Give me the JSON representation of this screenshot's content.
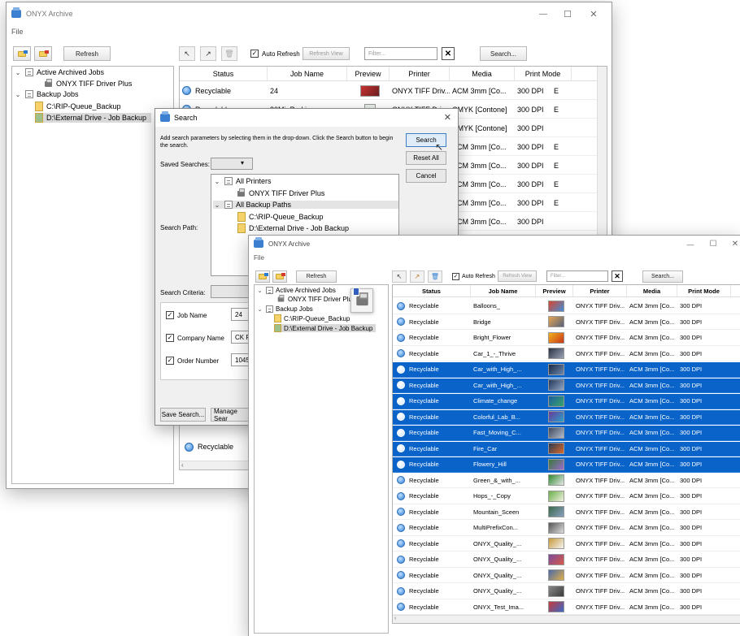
{
  "colors": {
    "selection": "#0a63c9",
    "accent": "#2f7fd3",
    "folder": "#f6d36a"
  },
  "back": {
    "title": "ONYX Archive",
    "menu": "File",
    "win_controls": {
      "min": "—",
      "max": "☐",
      "close": "✕"
    },
    "refresh": "Refresh",
    "auto_refresh": "Auto Refresh",
    "refresh_view": "Refresh View",
    "filter_placeholder": "Filter...",
    "search": "Search...",
    "tree": {
      "active": "Active Archived Jobs",
      "printer": "ONYX TIFF Driver Plus",
      "backup": "Backup Jobs",
      "path1": "C:\\RIP-Queue_Backup",
      "path2": "D:\\External Drive - Job Backup"
    },
    "columns": [
      "Status",
      "Job Name",
      "Preview",
      "Printer",
      "Media",
      "Print Mode"
    ],
    "rows": [
      {
        "status": "Recyclable",
        "job": "24",
        "printer": "ONYX TIFF Driv...",
        "media": "ACM 3mm [Co...",
        "mode": "300 DPI",
        "extra": "E"
      },
      {
        "status": "Recyclable",
        "job": "30MinParking",
        "printer": "ONYX TIFF Driv...",
        "media": "CMYK [Contone]",
        "mode": "300 DPI",
        "extra": "E"
      },
      {
        "media": "CMYK [Contone]",
        "mode": "300 DPI"
      },
      {
        "media": "ACM 3mm [Co...",
        "mode": "300 DPI",
        "extra": "E"
      },
      {
        "media": "ACM 3mm [Co...",
        "mode": "300 DPI",
        "extra": "E"
      },
      {
        "media": "ACM 3mm [Co...",
        "mode": "300 DPI",
        "extra": "E"
      },
      {
        "media": "ACM 3mm [Co...",
        "mode": "300 DPI",
        "extra": "E"
      },
      {
        "media": "ACM 3mm [Co...",
        "mode": "300 DPI"
      }
    ],
    "bottom_status": "Recyclable"
  },
  "dialog": {
    "title": "Search",
    "close": "✕",
    "instructions": "Add search parameters by selecting them in the drop-down. Click the Search button to begin the search.",
    "saved_label": "Saved Searches:",
    "path_label": "Search Path:",
    "criteria_label": "Search Criteria:",
    "search_btn": "Search",
    "reset_btn": "Reset All",
    "cancel_btn": "Cancel",
    "tree": {
      "all_printers": "All Printers",
      "printer": "ONYX TIFF Driver Plus",
      "all_paths": "All Backup Paths",
      "path1": "C:\\RIP-Queue_Backup",
      "path2": "D:\\External Drive - Job Backup"
    },
    "criteria": [
      {
        "label": "Job Name",
        "value": "24"
      },
      {
        "label": "Company Name",
        "value": "CK Pr"
      },
      {
        "label": "Order Number",
        "value": "1045"
      }
    ],
    "save_search": "Save Search...",
    "manage": "Manage Sear"
  },
  "front": {
    "title": "ONYX Archive",
    "menu": "File",
    "win_controls": {
      "min": "—",
      "max": "☐",
      "close": "✕"
    },
    "refresh": "Refresh",
    "auto_refresh": "Auto Refresh",
    "refresh_view": "Refresh View",
    "filter_placeholder": "Filter...",
    "search": "Search...",
    "tree": {
      "active": "Active Archived Jobs",
      "printer": "ONYX TIFF Driver Plus",
      "backup": "Backup Jobs",
      "path1": "C:\\RIP-Queue_Backup",
      "path2": "D:\\External Drive - Job Backup"
    },
    "columns": [
      "Status",
      "Job Name",
      "Preview",
      "Printer",
      "Media",
      "Print Mode"
    ],
    "rows": [
      {
        "status": "Recyclable",
        "job": "Balloons_",
        "printer": "ONYX TIFF Driv...",
        "media": "ACM 3mm [Co...",
        "mode": "300 DPI",
        "sel": false,
        "c1": "#d9462f",
        "c2": "#3f8fd6"
      },
      {
        "status": "Recyclable",
        "job": "Bridge",
        "printer": "ONYX TIFF Driv...",
        "media": "ACM 3mm [Co...",
        "mode": "300 DPI",
        "sel": false,
        "c1": "#e6a552",
        "c2": "#55617a"
      },
      {
        "status": "Recyclable",
        "job": "Bright_Flower",
        "printer": "ONYX TIFF Driv...",
        "media": "ACM 3mm [Co...",
        "mode": "300 DPI",
        "sel": false,
        "c1": "#f2b21c",
        "c2": "#c9361a"
      },
      {
        "status": "Recyclable",
        "job": "Car_1_-_Thrive",
        "printer": "ONYX TIFF Driv...",
        "media": "ACM 3mm [Co...",
        "mode": "300 DPI",
        "sel": false,
        "c1": "#2a3242",
        "c2": "#9aa4b8"
      },
      {
        "status": "Recyclable",
        "job": "Car_with_High_...",
        "printer": "ONYX TIFF Driv...",
        "media": "ACM 3mm [Co...",
        "mode": "300 DPI",
        "sel": true,
        "c1": "#1c2a44",
        "c2": "#6c87b0"
      },
      {
        "status": "Recyclable",
        "job": "Car_with_High_...",
        "printer": "ONYX TIFF Driv...",
        "media": "ACM 3mm [Co...",
        "mode": "300 DPI",
        "sel": true,
        "c1": "#243856",
        "c2": "#8fa6c9"
      },
      {
        "status": "Recyclable",
        "job": "Climate_change",
        "printer": "ONYX TIFF Driv...",
        "media": "ACM 3mm [Co...",
        "mode": "300 DPI",
        "sel": true,
        "c1": "#1c5fa0",
        "c2": "#3aa36a"
      },
      {
        "status": "Recyclable",
        "job": "Colorful_Lab_B...",
        "printer": "ONYX TIFF Driv...",
        "media": "ACM 3mm [Co...",
        "mode": "300 DPI",
        "sel": true,
        "c1": "#6a3a9a",
        "c2": "#2aa0c8"
      },
      {
        "status": "Recyclable",
        "job": "Fast_Moving_C...",
        "printer": "ONYX TIFF Driv...",
        "media": "ACM 3mm [Co...",
        "mode": "300 DPI",
        "sel": true,
        "c1": "#404a5c",
        "c2": "#b0bccf"
      },
      {
        "status": "Recyclable",
        "job": "Fire_Car",
        "printer": "ONYX TIFF Driv...",
        "media": "ACM 3mm [Co...",
        "mode": "300 DPI",
        "sel": true,
        "c1": "#2b3a54",
        "c2": "#d86a2a"
      },
      {
        "status": "Recyclable",
        "job": "Flowery_Hill",
        "printer": "ONYX TIFF Driv...",
        "media": "ACM 3mm [Co...",
        "mode": "300 DPI",
        "sel": true,
        "c1": "#3a7a3a",
        "c2": "#9a6ad0"
      },
      {
        "status": "Recyclable",
        "job": "Green_&_with_...",
        "printer": "ONYX TIFF Driv...",
        "media": "ACM 3mm [Co...",
        "mode": "300 DPI",
        "sel": false,
        "c1": "#2f8a2f",
        "c2": "#e8e8e8"
      },
      {
        "status": "Recyclable",
        "job": "Hops_-_Copy",
        "printer": "ONYX TIFF Driv...",
        "media": "ACM 3mm [Co...",
        "mode": "300 DPI",
        "sel": false,
        "c1": "#6ab04a",
        "c2": "#f0f0e0"
      },
      {
        "status": "Recyclable",
        "job": "Mountain_Sceen",
        "printer": "ONYX TIFF Driv...",
        "media": "ACM 3mm [Co...",
        "mode": "300 DPI",
        "sel": false,
        "c1": "#3a6a4a",
        "c2": "#8aa0c0"
      },
      {
        "status": "Recyclable",
        "job": "MultiPrefixCon...",
        "printer": "ONYX TIFF Driv...",
        "media": "ACM 3mm [Co...",
        "mode": "300 DPI",
        "sel": false,
        "c1": "#555555",
        "c2": "#dddddd"
      },
      {
        "status": "Recyclable",
        "job": "ONYX_Quality_...",
        "printer": "ONYX TIFF Driv...",
        "media": "ACM 3mm [Co...",
        "mode": "300 DPI",
        "sel": false,
        "c1": "#c89a3a",
        "c2": "#f4f4f4"
      },
      {
        "status": "Recyclable",
        "job": "ONYX_Quality_...",
        "printer": "ONYX TIFF Driv...",
        "media": "ACM 3mm [Co...",
        "mode": "300 DPI",
        "sel": false,
        "c1": "#7a4a9a",
        "c2": "#d85a4a"
      },
      {
        "status": "Recyclable",
        "job": "ONYX_Quality_...",
        "printer": "ONYX TIFF Driv...",
        "media": "ACM 3mm [Co...",
        "mode": "300 DPI",
        "sel": false,
        "c1": "#4a6aaa",
        "c2": "#e0b04a"
      },
      {
        "status": "Recyclable",
        "job": "ONYX_Quality_...",
        "printer": "ONYX TIFF Driv...",
        "media": "ACM 3mm [Co...",
        "mode": "300 DPI",
        "sel": false,
        "c1": "#888888",
        "c2": "#3a3a3a"
      },
      {
        "status": "Recyclable",
        "job": "ONYX_Test_Ima...",
        "printer": "ONYX TIFF Driv...",
        "media": "ACM 3mm [Co...",
        "mode": "300 DPI",
        "sel": false,
        "c1": "#c83a3a",
        "c2": "#3a6ac8"
      }
    ]
  }
}
